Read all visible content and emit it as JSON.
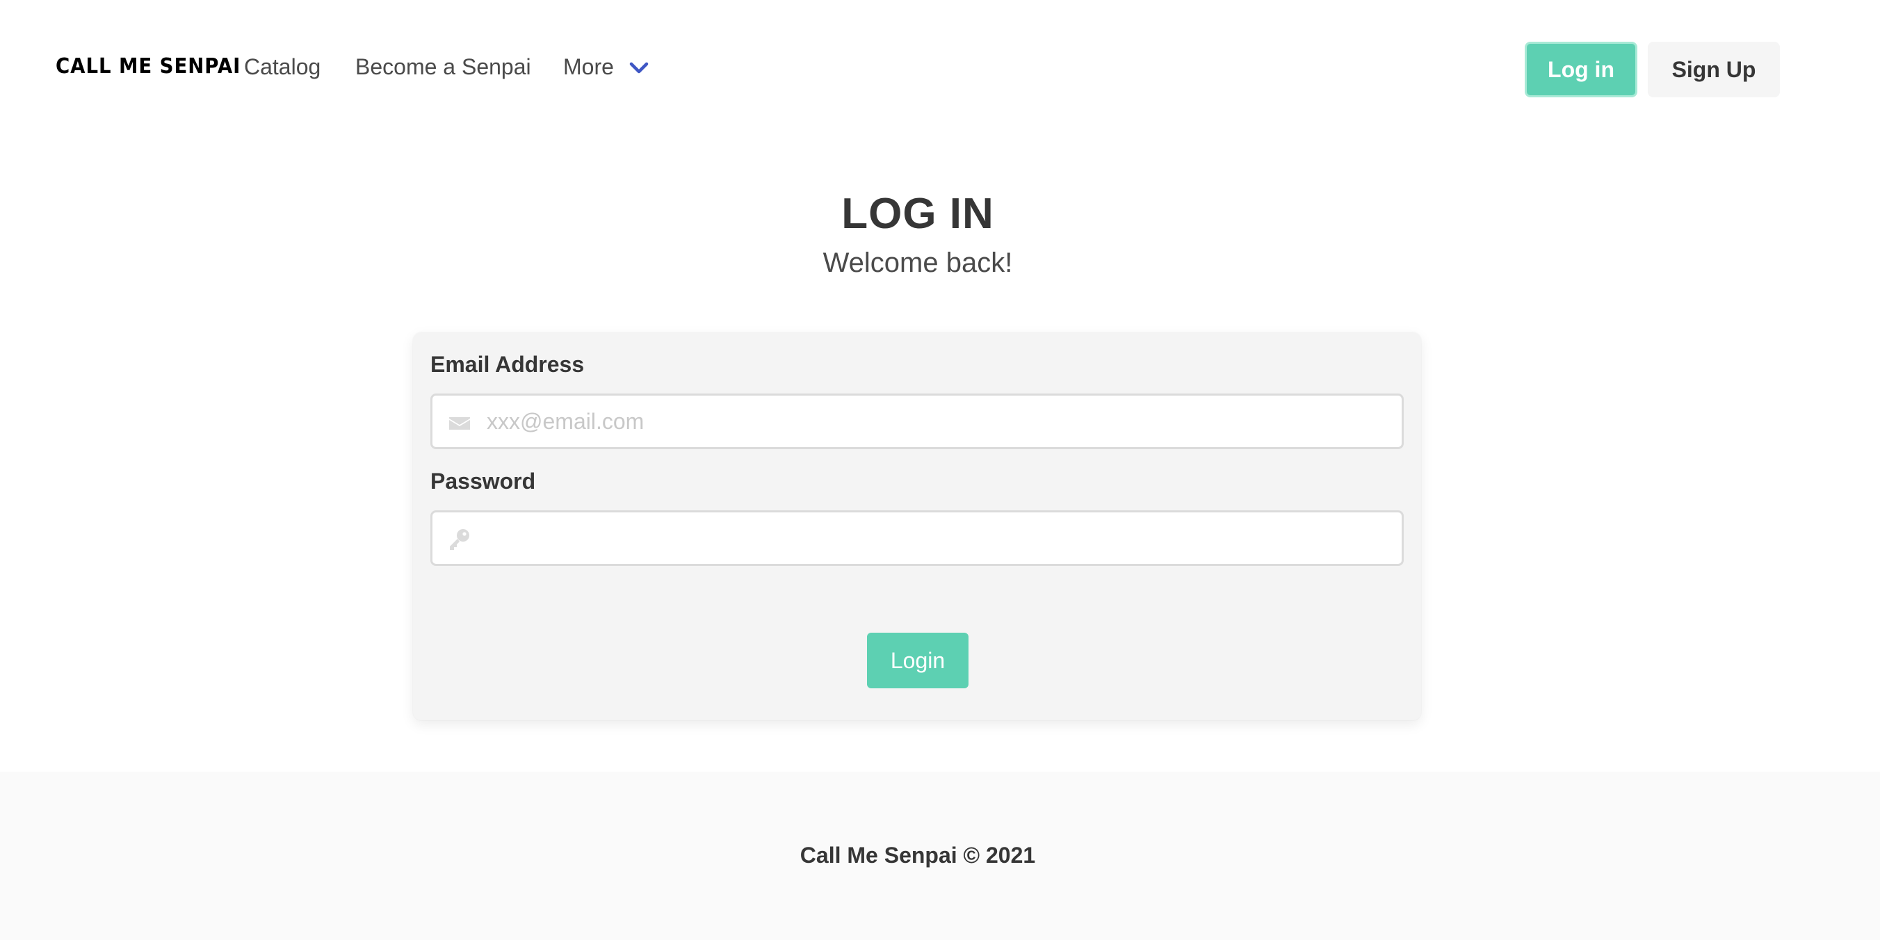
{
  "navbar": {
    "brand": "CALL ME SENPAI",
    "links": [
      "Catalog",
      "Become a Senpai"
    ],
    "more_label": "More",
    "login_label": "Log in",
    "signup_label": "Sign Up"
  },
  "header": {
    "title": "LOG IN",
    "subtitle": "Welcome back!"
  },
  "form": {
    "email_label": "Email Address",
    "email_placeholder": "xxx@email.com",
    "email_value": "",
    "email_icon": "envelope-icon",
    "password_label": "Password",
    "password_value": "",
    "password_icon": "key-icon",
    "submit_label": "Login"
  },
  "footer": {
    "text": "Call Me Senpai © 2021"
  },
  "colors": {
    "primary": "#5dd0b2",
    "chevron": "#3e56c4",
    "text": "#363636",
    "card_bg": "#f4f4f4",
    "footer_bg": "#fafafa"
  }
}
